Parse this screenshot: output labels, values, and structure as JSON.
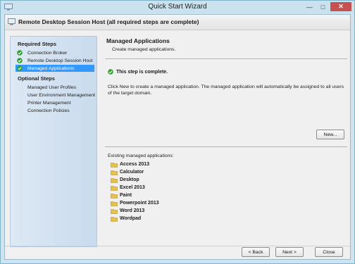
{
  "window": {
    "title": "Quick Start Wizard"
  },
  "header": {
    "title": "Remote Desktop Session Host  (all required steps are complete)"
  },
  "sidebar": {
    "required_heading": "Required Steps",
    "required_items": [
      {
        "label": "Connection Broker",
        "completed": true,
        "selected": false
      },
      {
        "label": "Remote Desktop Session Host",
        "completed": true,
        "selected": false
      },
      {
        "label": "Managed Applications",
        "completed": true,
        "selected": true
      }
    ],
    "optional_heading": "Optional Steps",
    "optional_items": [
      {
        "label": "Managed User Profiles"
      },
      {
        "label": "User Environment Management"
      },
      {
        "label": "Printer Management"
      },
      {
        "label": "Connection Policies"
      }
    ]
  },
  "main": {
    "title": "Managed Applications",
    "subtitle": "Create managed applications.",
    "status": "This step is complete.",
    "description": "Click New to create a managed application.  The managed application will automatically be assigned to all users of the target domain.",
    "new_button": "New...",
    "existing_label": "Existing managed applications:",
    "applications": [
      "Access 2013",
      "Calculator",
      "Desktop",
      "Excel 2013",
      "Paint",
      "Powerpoint 2013",
      "Word 2013",
      "Wordpad"
    ]
  },
  "footer": {
    "back_label": "< Back",
    "next_label": "Next >",
    "close_label": "Close"
  },
  "colors": {
    "selected": "#3399ff",
    "check": "#2aa02a",
    "folder": "#e8c14a"
  }
}
